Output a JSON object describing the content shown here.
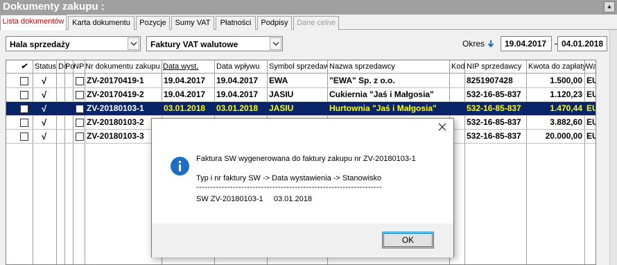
{
  "window": {
    "title": "Dokumenty zakupu :"
  },
  "tabs": [
    {
      "label": "Lista dokumentów",
      "state": "active"
    },
    {
      "label": "Karta dokumentu",
      "state": "normal"
    },
    {
      "label": "Pozycje",
      "state": "normal"
    },
    {
      "label": "Sumy VAT",
      "state": "normal"
    },
    {
      "label": "Płatności",
      "state": "normal"
    },
    {
      "label": "Podpisy",
      "state": "normal"
    },
    {
      "label": "Dane celne",
      "state": "disabled"
    }
  ],
  "filters": {
    "warehouse": "Hala sprzedaży",
    "doc_type": "Faktury VAT walutowe",
    "period_label": "Okres",
    "date_from": "19.04.2017",
    "date_to": "04.01.2018"
  },
  "grid": {
    "columns": {
      "check": "✔",
      "status": "Status",
      "de": "De",
      "po": "Po",
      "np": "NP",
      "docnr": "Nr dokumentu zakupu",
      "date_issue": "Data wyst.",
      "date_receipt": "Data wpływu",
      "supplier_symbol": "Symbol sprzedawcy",
      "supplier_name": "Nazwa sprzedawcy",
      "code": "Kod",
      "nip": "NIP sprzedawcy",
      "amount": "Kwota do zapłaty",
      "currency": "Wa"
    },
    "rows": [
      {
        "status": "√",
        "docnr": "ZV-20170419-1",
        "date_issue": "19.04.2017",
        "date_receipt": "19.04.2017",
        "supplier_symbol": "EWA",
        "supplier_name": "\"EWA\" Sp. z o.o.",
        "code": "",
        "nip": "8251907428",
        "amount": "1.500,00",
        "currency": "EU"
      },
      {
        "status": "√",
        "docnr": "ZV-20170419-2",
        "date_issue": "19.04.2017",
        "date_receipt": "19.04.2017",
        "supplier_symbol": "JASIU",
        "supplier_name": "Cukiernia \"Jaś i Małgosia\"",
        "code": "",
        "nip": "532-16-85-837",
        "amount": "1.120,23",
        "currency": "EU"
      },
      {
        "status": "√",
        "docnr": "ZV-20180103-1",
        "date_issue": "03.01.2018",
        "date_receipt": "03.01.2018",
        "supplier_symbol": "JASIU",
        "supplier_name": "Hurtownia \"Jaś i Małgosia\"",
        "code": "",
        "nip": "532-16-85-837",
        "amount": "1.470,44",
        "currency": "EU"
      },
      {
        "status": "√",
        "docnr": "ZV-20180103-2",
        "date_issue": "",
        "date_receipt": "",
        "supplier_symbol": "",
        "supplier_name": "",
        "code": "",
        "nip": "532-16-85-837",
        "amount": "3.882,60",
        "currency": "EU"
      },
      {
        "status": "√",
        "docnr": "ZV-20180103-3",
        "date_issue": "",
        "date_receipt": "",
        "supplier_symbol": "",
        "supplier_name": "",
        "code": "",
        "nip": "532-16-85-837",
        "amount": "20.000,00",
        "currency": "EU"
      }
    ]
  },
  "dialog": {
    "line1": "Faktura SW wygenerowana do faktury zakupu nr ZV-20180103-1",
    "line2": "Typ i nr faktury SW -> Data wystawienia -> Stanowisko",
    "separator": "------------------------------------------------------------------",
    "line3": "SW ZV-20180103-1     03.01.2018",
    "ok_label": "OK"
  },
  "colors": {
    "selection_bg": "#0a246a",
    "selection_fg": "#ffff00",
    "active_tab_text": "#d00000",
    "info_icon": "#1c6fc4"
  }
}
